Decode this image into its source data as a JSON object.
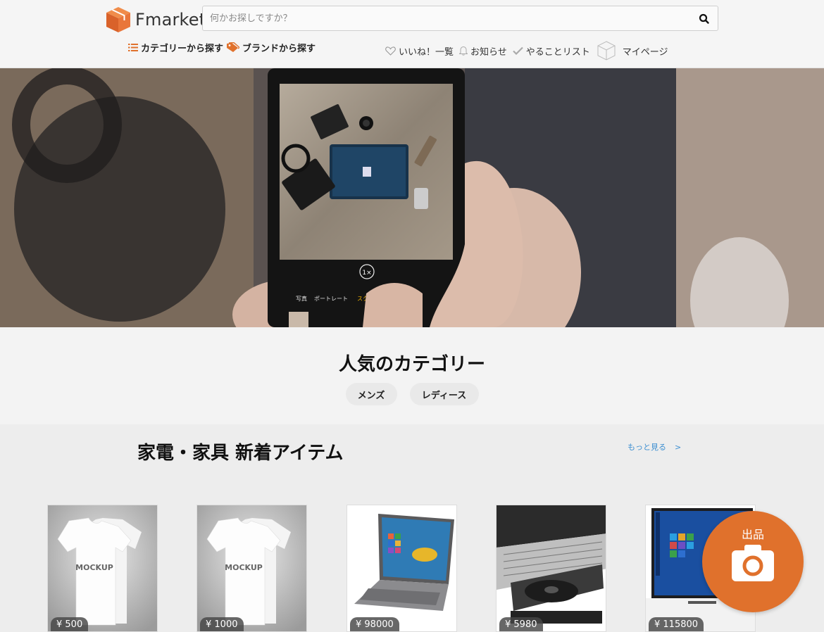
{
  "header": {
    "logo_text": "Fmarket",
    "search_placeholder": "何かお探しですか？",
    "nav_left": [
      {
        "label": "カテゴリーから探す",
        "icon": "list-icon"
      },
      {
        "label": "ブランドから探す",
        "icon": "tag-icon"
      }
    ],
    "nav_right": [
      {
        "label": "いいね！一覧",
        "icon": "heart-icon"
      },
      {
        "label": "お知らせ",
        "icon": "bell-icon"
      },
      {
        "label": "やることリスト",
        "icon": "check-icon"
      },
      {
        "label": "マイページ",
        "icon": "box-icon"
      }
    ]
  },
  "hero": {
    "camera_zoom": "1×",
    "camera_modes": [
      "写真",
      "ポートレート",
      "スクエ"
    ]
  },
  "popular": {
    "title": "人気のカテゴリー",
    "chips": [
      "メンズ",
      "レディース"
    ]
  },
  "new_items": {
    "title": "家電・家具 新着アイテム",
    "more_label": "もっと見る",
    "more_arrow": ">",
    "items": [
      {
        "price": "¥ 500",
        "kind": "tshirt",
        "print": "MOCKUP"
      },
      {
        "price": "¥ 1000",
        "kind": "tshirt",
        "print": "MOCKUP"
      },
      {
        "price": "¥ 98000",
        "kind": "laptop"
      },
      {
        "price": "¥ 5980",
        "kind": "dvd-drive"
      },
      {
        "price": "¥ 115800",
        "kind": "laptop-white"
      }
    ]
  },
  "fab": {
    "label": "出品",
    "icon": "camera-icon"
  },
  "colors": {
    "accent": "#e0712c",
    "link": "#3d8fd1"
  }
}
